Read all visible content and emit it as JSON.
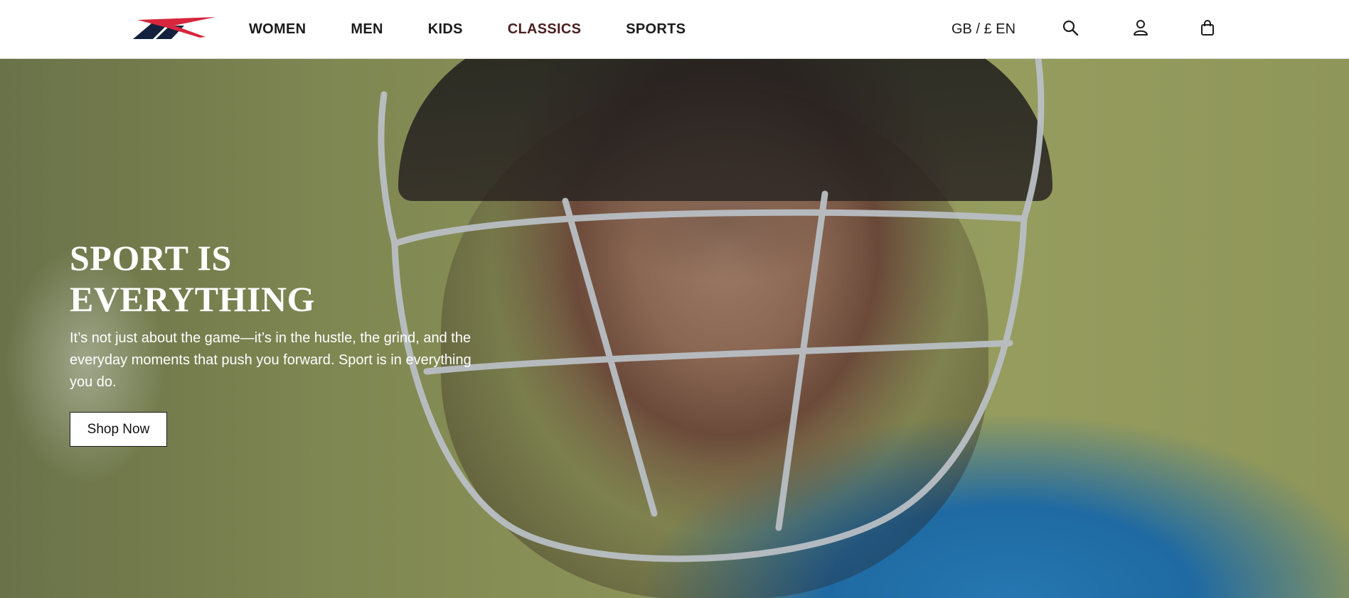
{
  "brand": {
    "logo_icon": "reebok-vector-logo-icon",
    "colors": {
      "navy": "#14213d",
      "red": "#d7263d"
    }
  },
  "nav": {
    "items": [
      {
        "label": "WOMEN"
      },
      {
        "label": "MEN"
      },
      {
        "label": "KIDS"
      },
      {
        "label": "CLASSICS"
      },
      {
        "label": "SPORTS"
      }
    ]
  },
  "header": {
    "locale": "GB / £ EN",
    "icons": {
      "search": "search-icon",
      "account": "account-icon",
      "bag": "bag-icon"
    }
  },
  "hero": {
    "title": "SPORT IS EVERYTHING",
    "text": "It’s not just about the game—it’s in the hustle, the grind, and the everyday moments that push you forward. Sport is in everything you do.",
    "cta_label": "Shop Now",
    "image": "cricket-player-helmet-photo"
  }
}
